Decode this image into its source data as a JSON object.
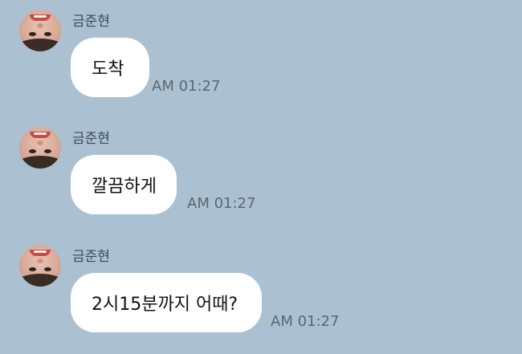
{
  "messages": [
    {
      "sender": "금준현",
      "text": "도착",
      "time": "AM 01:27"
    },
    {
      "sender": "금준현",
      "text": "깔끔하게",
      "time": "AM 01:27"
    },
    {
      "sender": "금준현",
      "text": "2시15분까지 어때?",
      "time": "AM 01:27"
    }
  ],
  "colors": {
    "background": "#abc1d1",
    "bubble": "#ffffff",
    "timestamp": "#5d6670",
    "sender": "#3f4a55"
  },
  "icons": {
    "avatar": "profile-photo-avatar"
  }
}
